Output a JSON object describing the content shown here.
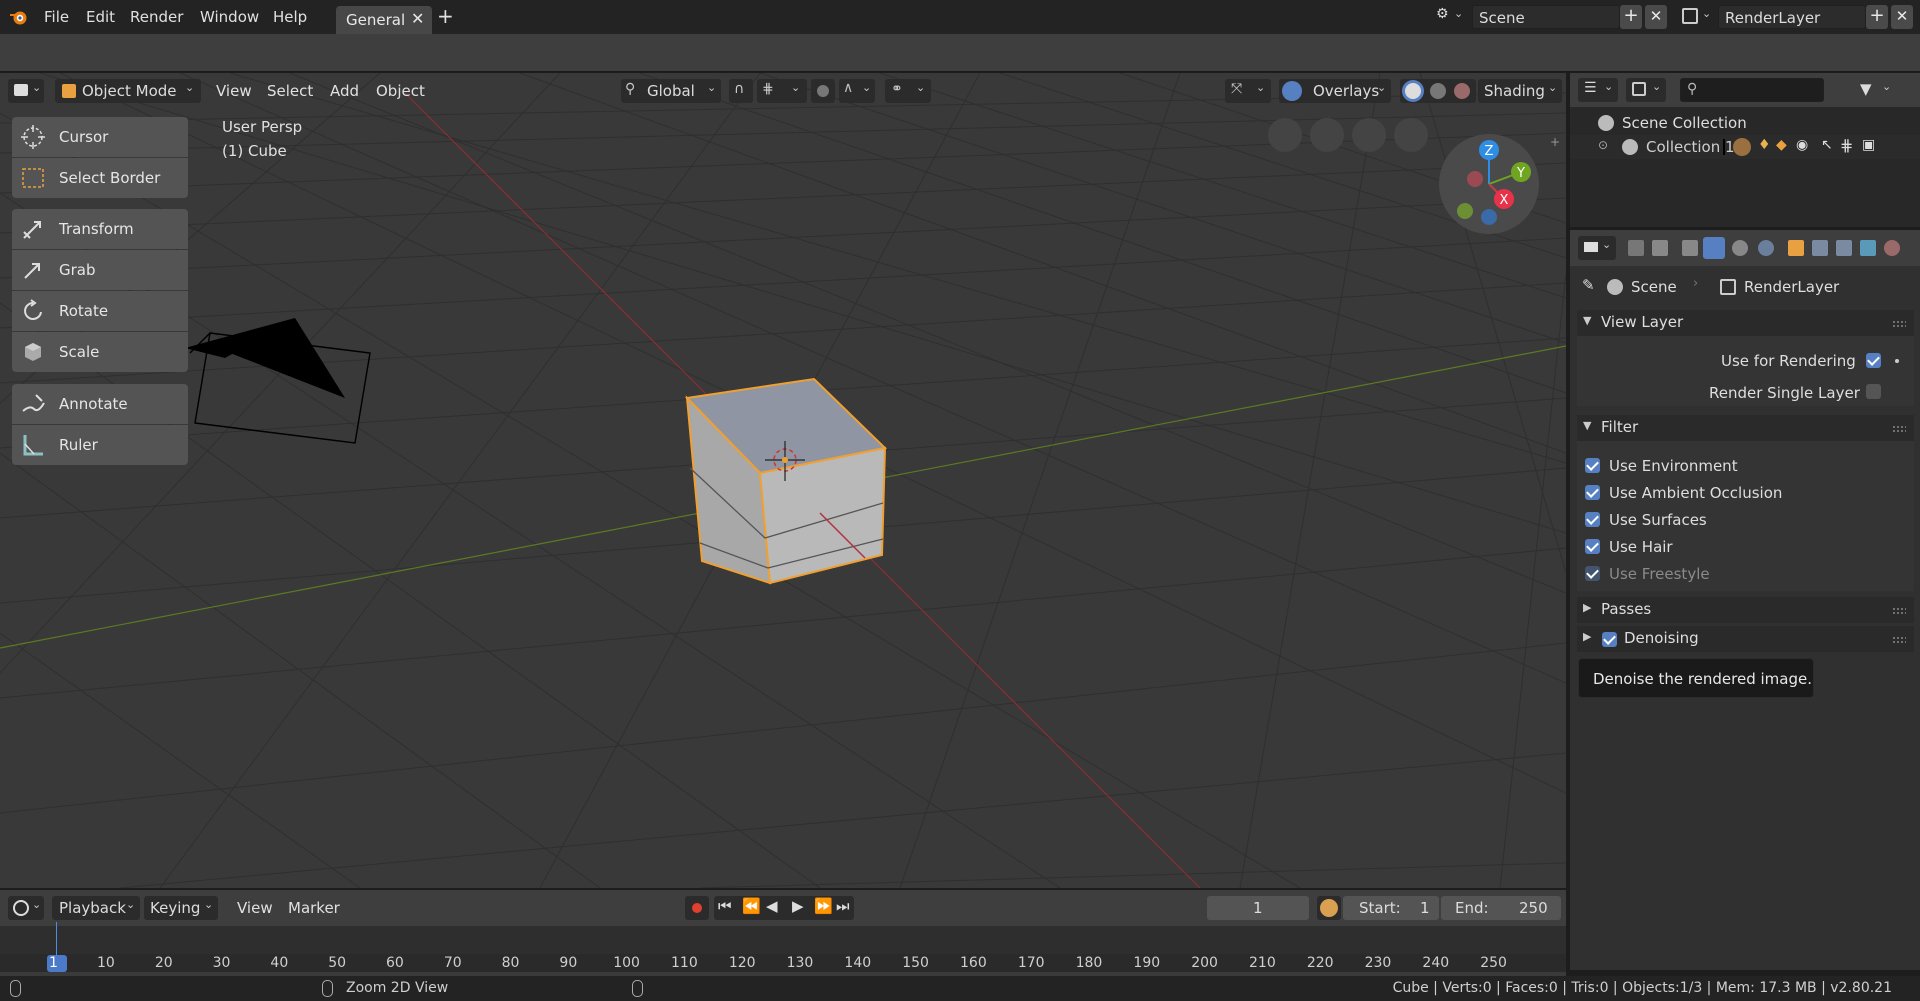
{
  "topbar": {
    "menu": [
      "File",
      "Edit",
      "Render",
      "Window",
      "Help"
    ],
    "workspace_tab": "General",
    "scene_field": "Scene",
    "renderlayer_field": "RenderLayer"
  },
  "viewport_header": {
    "mode": "Object Mode",
    "menus": [
      "View",
      "Select",
      "Add",
      "Object"
    ],
    "orientation": "Global",
    "overlays": "Overlays",
    "shading": "Shading"
  },
  "viewport": {
    "view_name": "User Persp",
    "active_object": "(1) Cube",
    "gizmo_axes": [
      "Z",
      "Y",
      "X"
    ]
  },
  "toolbar": {
    "tools": [
      "Cursor",
      "Select Border",
      "Transform",
      "Grab",
      "Rotate",
      "Scale",
      "Annotate",
      "Ruler"
    ]
  },
  "outliner": {
    "root": "Scene Collection",
    "child": "Collection 1"
  },
  "properties": {
    "breadcrumb_scene": "Scene",
    "breadcrumb_layer": "RenderLayer",
    "view_layer_title": "View Layer",
    "use_for_rendering": "Use for Rendering",
    "render_single_layer": "Render Single Layer",
    "filter_title": "Filter",
    "filters": [
      {
        "label": "Use Environment",
        "checked": true
      },
      {
        "label": "Use Ambient Occlusion",
        "checked": true
      },
      {
        "label": "Use Surfaces",
        "checked": true
      },
      {
        "label": "Use Hair",
        "checked": true
      },
      {
        "label": "Use Freestyle",
        "checked": true
      }
    ],
    "passes_title": "Passes",
    "denoising_title": "Denoising",
    "tooltip": "Denoise the rendered image."
  },
  "timeline": {
    "menus": [
      "Playback",
      "Keying",
      "View",
      "Marker"
    ],
    "current_frame": "1",
    "start_label": "Start:",
    "start_value": "1",
    "end_label": "End:",
    "end_value": "250",
    "ticks": [
      "1",
      "10",
      "20",
      "30",
      "40",
      "50",
      "60",
      "70",
      "80",
      "90",
      "100",
      "110",
      "120",
      "130",
      "140",
      "150",
      "160",
      "170",
      "180",
      "190",
      "200",
      "210",
      "220",
      "230",
      "240",
      "250"
    ]
  },
  "statusbar": {
    "hint": "Zoom 2D View",
    "stats": "Cube | Verts:0 | Faces:0 | Tris:0 | Objects:1/3 | Mem: 17.3 MB | v2.80.21"
  },
  "colors": {
    "accent_blue": "#5680c2",
    "selection_orange": "#f0a030",
    "axis_x_red": "#c83c48",
    "axis_y_green": "#6fa520",
    "axis_z_blue": "#2e8ee6"
  }
}
